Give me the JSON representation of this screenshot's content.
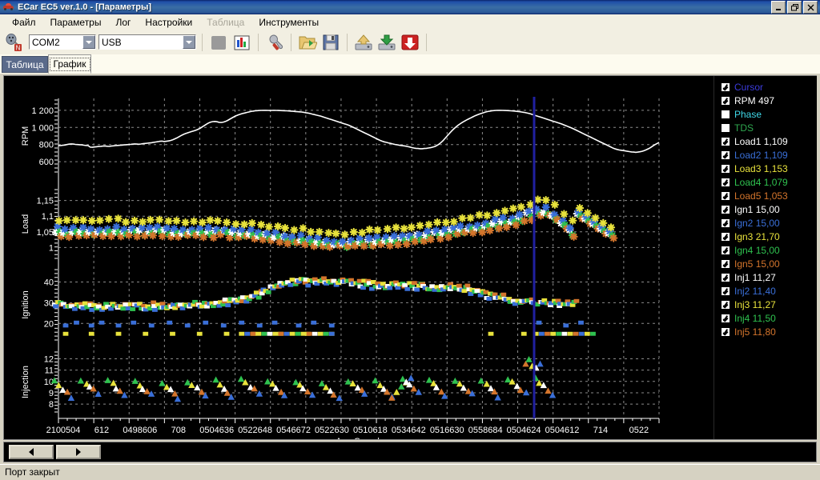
{
  "window": {
    "title": "ECar EC5 ver.1.0 - [Параметры]",
    "icon": "car-icon",
    "buttons": [
      {
        "name": "minimize-button",
        "glyph": "_"
      },
      {
        "name": "restore-button",
        "glyph": "❐"
      },
      {
        "name": "close-button",
        "glyph": "✕"
      }
    ]
  },
  "menu": {
    "items": [
      {
        "label": "Файл",
        "disabled": false
      },
      {
        "label": "Параметры",
        "disabled": false
      },
      {
        "label": "Лог",
        "disabled": false
      },
      {
        "label": "Настройки",
        "disabled": false
      },
      {
        "label": "Таблица",
        "disabled": true
      },
      {
        "label": "Инструменты",
        "disabled": false
      }
    ]
  },
  "toolbar": {
    "connect_icon": "plug-connect-icon",
    "port_combo": {
      "value": "COM2",
      "placeholder": "COM2"
    },
    "iface_combo": {
      "value": "USB",
      "placeholder": "USB"
    },
    "buttons": [
      {
        "name": "stop-button",
        "icon": "stop-square-icon"
      },
      {
        "name": "chart-button",
        "icon": "bar-chart-icon"
      },
      {
        "name": "settings-wrench-button",
        "icon": "wrench-icon"
      },
      {
        "name": "open-folder-button",
        "icon": "open-folder-icon"
      },
      {
        "name": "save-button",
        "icon": "floppy-disk-icon"
      },
      {
        "name": "upload-button",
        "icon": "upload-drive-icon"
      },
      {
        "name": "download-button",
        "icon": "download-drive-icon"
      },
      {
        "name": "flash-write-button",
        "icon": "red-down-arrow-icon"
      }
    ]
  },
  "tabs": [
    {
      "label": "Таблица",
      "active": false
    },
    {
      "label": "График",
      "active": true
    }
  ],
  "navigation": {
    "prev_label": "◀",
    "next_label": "▶"
  },
  "status": {
    "message": "Порт закрыт"
  },
  "legend": {
    "items": [
      {
        "label": "Cursor",
        "checked": true,
        "color": "#3b3bdc"
      },
      {
        "label": "RPM 497",
        "checked": true,
        "color": "#ffffff"
      },
      {
        "label": "Phase",
        "checked": false,
        "color": "#3fd8e8"
      },
      {
        "label": "TDS",
        "checked": false,
        "color": "#2fa84f"
      },
      {
        "label": "Load1 1,109",
        "checked": true,
        "color": "#ffffff"
      },
      {
        "label": "Load2 1,109",
        "checked": true,
        "color": "#3a6fd8"
      },
      {
        "label": "Load3 1,153",
        "checked": true,
        "color": "#e8e23c"
      },
      {
        "label": "Load4 1,079",
        "checked": true,
        "color": "#2fc24f"
      },
      {
        "label": "Load5 1,053",
        "checked": true,
        "color": "#d4752c"
      },
      {
        "label": "Ign1 15,00",
        "checked": true,
        "color": "#ffffff"
      },
      {
        "label": "Ign2 15,00",
        "checked": true,
        "color": "#3a6fd8"
      },
      {
        "label": "Ign3 21,70",
        "checked": true,
        "color": "#e8e23c"
      },
      {
        "label": "Ign4 15,00",
        "checked": true,
        "color": "#2fc24f"
      },
      {
        "label": "Ign5 15,00",
        "checked": true,
        "color": "#d4752c"
      },
      {
        "label": "Inj1 11,27",
        "checked": true,
        "color": "#ffffff"
      },
      {
        "label": "Inj2 11,40",
        "checked": true,
        "color": "#3a6fd8"
      },
      {
        "label": "Inj3 11,27",
        "checked": true,
        "color": "#e8e23c"
      },
      {
        "label": "Inj4 11,50",
        "checked": true,
        "color": "#2fc24f"
      },
      {
        "label": "Inj5 11,80",
        "checked": true,
        "color": "#d4752c"
      }
    ]
  },
  "chart_data": {
    "type": "scatter",
    "title": "",
    "xlabel": "Ang Crunck",
    "grid": true,
    "legend_position": "right",
    "background": "#000000",
    "grid_color": "#8a8a8a",
    "cursor_x_pct": 79.2,
    "cursor_color": "#2020a0",
    "xtick_labels": [
      "2100504",
      "612",
      "0498606",
      "708",
      "0504636",
      "0522648",
      "0546672",
      "0522630",
      "0510618",
      "0534642",
      "0516630",
      "0558684",
      "0504624",
      "0504612",
      "714",
      "0522"
    ],
    "panels": [
      {
        "name": "RPM",
        "ylabel": "RPM",
        "yticks": [
          600,
          800,
          1000,
          1200
        ],
        "ytick_labels": [
          "600",
          "800",
          "1 000",
          "1 200"
        ],
        "ylim": [
          480,
          1320
        ],
        "series": [
          {
            "name": "RPM",
            "color": "#ffffff",
            "marker": "line",
            "values": [
              790,
              788,
              792,
              795,
              800,
              805,
              808,
              806,
              802,
              800,
              798,
              796,
              793,
              790,
              788,
              770,
              768,
              772,
              775,
              778,
              780,
              782,
              784,
              781,
              779,
              782,
              785,
              788,
              790,
              792,
              794,
              796,
              798,
              800,
              802,
              805,
              808,
              806,
              804,
              807,
              810,
              813,
              816,
              819,
              822,
              826,
              830,
              834,
              838,
              840,
              836,
              838,
              842,
              848,
              856,
              866,
              878,
              892,
              906,
              918,
              928,
              936,
              944,
              952,
              960,
              968,
              978,
              990,
              1006,
              1022,
              1038,
              1052,
              1062,
              1068,
              1070,
              1066,
              1060,
              1058,
              1062,
              1070,
              1082,
              1096,
              1110,
              1124,
              1136,
              1146,
              1154,
              1162,
              1168,
              1174,
              1180,
              1186,
              1190,
              1194,
              1196,
              1198,
              1199,
              1200,
              1200,
              1199,
              1198,
              1199,
              1200,
              1199,
              1198,
              1197,
              1196,
              1195,
              1194,
              1192,
              1190,
              1188,
              1186,
              1184,
              1182,
              1180,
              1176,
              1172,
              1168,
              1162,
              1156,
              1150,
              1144,
              1138,
              1132,
              1124,
              1116,
              1108,
              1100,
              1092,
              1084,
              1076,
              1068,
              1060,
              1052,
              1044,
              1036,
              1028,
              1018,
              1006,
              994,
              982,
              970,
              958,
              946,
              934,
              922,
              910,
              898,
              886,
              874,
              862,
              850,
              840,
              832,
              826,
              820,
              814,
              808,
              802,
              798,
              794,
              790,
              786,
              782,
              778,
              772,
              766,
              760,
              756,
              754,
              752,
              752,
              754,
              756,
              760,
              764,
              770,
              778,
              790,
              806,
              826,
              850,
              878,
              906,
              934,
              960,
              984,
              1006,
              1026,
              1044,
              1060,
              1074,
              1088,
              1100,
              1112,
              1124,
              1136,
              1146,
              1156,
              1164,
              1172,
              1180,
              1186,
              1190,
              1194,
              1197,
              1199,
              1200,
              1200,
              1199,
              1198,
              1197,
              1196,
              1194,
              1192,
              1190,
              1187,
              1184,
              1180,
              1176,
              1172,
              1166,
              1160,
              1152,
              1144,
              1136,
              1128,
              1120,
              1112,
              1104,
              1096,
              1088,
              1080,
              1072,
              1064,
              1056,
              1048,
              1040,
              1030,
              1020,
              1010,
              1000,
              990,
              978,
              966,
              954,
              942,
              930,
              918,
              906,
              894,
              882,
              870,
              858,
              846,
              834,
              822,
              810,
              798,
              786,
              774,
              762,
              752,
              744,
              738,
              734,
              730,
              726,
              722,
              718,
              714,
              712,
              710,
              712,
              716,
              722,
              730,
              740,
              752,
              766,
              782,
              798,
              812,
              824
            ]
          }
        ]
      },
      {
        "name": "Load",
        "ylabel": "Load",
        "yticks": [
          1,
          1.05,
          1.1,
          1.15
        ],
        "ytick_labels": [
          "1",
          "1,05",
          "1,1",
          "1,15"
        ],
        "ylim": [
          0.965,
          1.185
        ],
        "series": [
          {
            "name": "Load1",
            "color": "#ffffff",
            "marker": "star",
            "current": 1.109
          },
          {
            "name": "Load2",
            "color": "#3a6fd8",
            "marker": "star",
            "current": 1.109
          },
          {
            "name": "Load3",
            "color": "#e8e23c",
            "marker": "star",
            "current": 1.153
          },
          {
            "name": "Load4",
            "color": "#2fc24f",
            "marker": "star",
            "current": 1.079
          },
          {
            "name": "Load5",
            "color": "#d4752c",
            "marker": "star",
            "current": 1.053
          }
        ],
        "trend": [
          1.052,
          1.048,
          1.05,
          1.052,
          1.051,
          1.049,
          1.05,
          1.052,
          1.053,
          1.051,
          1.05,
          1.049,
          1.051,
          1.053,
          1.052,
          1.05,
          1.049,
          1.048,
          1.047,
          1.046,
          1.047,
          1.049,
          1.05,
          1.048,
          1.046,
          1.044,
          1.042,
          1.04,
          1.038,
          1.036,
          1.033,
          1.03,
          1.027,
          1.024,
          1.021,
          1.018,
          1.016,
          1.014,
          1.013,
          1.012,
          1.013,
          1.015,
          1.017,
          1.02,
          1.022,
          1.024,
          1.026,
          1.028,
          1.03,
          1.033,
          1.036,
          1.04,
          1.044,
          1.048,
          1.052,
          1.056,
          1.06,
          1.064,
          1.068,
          1.072,
          1.076,
          1.08,
          1.086,
          1.094,
          1.102,
          1.112,
          1.12,
          1.11,
          1.095,
          1.072,
          1.05
        ]
      },
      {
        "name": "Ignition",
        "ylabel": "Ignition",
        "yticks": [
          20,
          30,
          40
        ],
        "ytick_labels": [
          "20",
          "30",
          "40"
        ],
        "ylim": [
          12,
          46
        ],
        "series": [
          {
            "name": "Ign1",
            "color": "#ffffff",
            "marker": "square",
            "current": 15.0
          },
          {
            "name": "Ign2",
            "color": "#3a6fd8",
            "marker": "square",
            "current": 15.0
          },
          {
            "name": "Ign3",
            "color": "#e8e23c",
            "marker": "square",
            "current": 21.7
          },
          {
            "name": "Ign4",
            "color": "#2fc24f",
            "marker": "square",
            "current": 15.0
          },
          {
            "name": "Ign5",
            "color": "#d4752c",
            "marker": "square",
            "current": 15.0
          }
        ],
        "trend": [
          29,
          29,
          28.5,
          28,
          28,
          28,
          28,
          28,
          28,
          28,
          28,
          28,
          28,
          28,
          28.5,
          29,
          29,
          29,
          29.5,
          30,
          30.5,
          31,
          32,
          34,
          36,
          38,
          39,
          40,
          40,
          40,
          40.5,
          40,
          40,
          40,
          39.5,
          39,
          38.5,
          38,
          38,
          38,
          38,
          38,
          37.5,
          37,
          37,
          37,
          36.5,
          36,
          35,
          34,
          33,
          32,
          31,
          30,
          30,
          30,
          30,
          30,
          29,
          29
        ]
      },
      {
        "name": "Injection",
        "ylabel": "Injection",
        "yticks": [
          8,
          9,
          10,
          11,
          12
        ],
        "ytick_labels": [
          "8",
          "9",
          "10",
          "11",
          "12"
        ],
        "ylim": [
          7.3,
          12.6
        ],
        "series": [
          {
            "name": "Inj1",
            "color": "#ffffff",
            "marker": "triangle",
            "current": 11.27
          },
          {
            "name": "Inj2",
            "color": "#3a6fd8",
            "marker": "triangle",
            "current": 11.4
          },
          {
            "name": "Inj3",
            "color": "#e8e23c",
            "marker": "triangle",
            "current": 11.27
          },
          {
            "name": "Inj4",
            "color": "#2fc24f",
            "marker": "triangle",
            "current": 11.5
          },
          {
            "name": "Inj5",
            "color": "#d4752c",
            "marker": "triangle",
            "current": 11.8
          }
        ],
        "trend": [
          10,
          9.9,
          10,
          10.1,
          10,
          9.9,
          10,
          10.1,
          10,
          9.9,
          10,
          10.1,
          10,
          10.2,
          10,
          9.8,
          10,
          10.3,
          10,
          9.7,
          10.1,
          10.2,
          10,
          9.9,
          10.1,
          10,
          10.2,
          10,
          9.9,
          10.1
        ]
      }
    ]
  }
}
